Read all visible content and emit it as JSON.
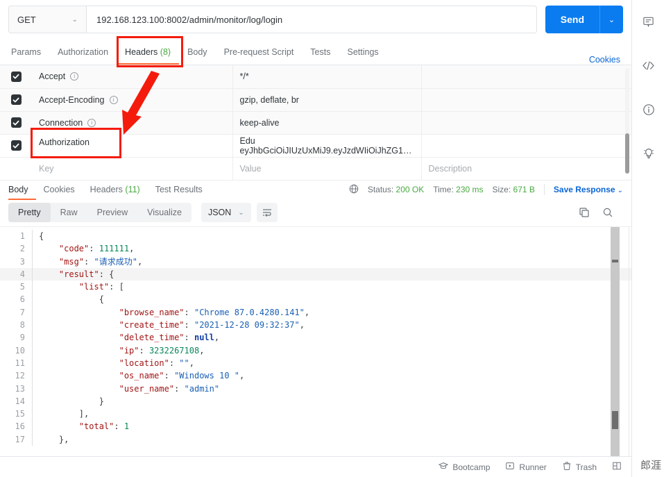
{
  "request": {
    "method": "GET",
    "method_caret": "⌄",
    "url": "192.168.123.100:8002/admin/monitor/log/login",
    "send_label": "Send",
    "send_caret": "⌄",
    "tabs": [
      {
        "label": "Params",
        "active": false
      },
      {
        "label": "Authorization",
        "active": false
      },
      {
        "label": "Headers",
        "count": "(8)",
        "active": true
      },
      {
        "label": "Body",
        "active": false
      },
      {
        "label": "Pre-request Script",
        "active": false
      },
      {
        "label": "Tests",
        "active": false
      },
      {
        "label": "Settings",
        "active": false
      }
    ],
    "cookies_link": "Cookies"
  },
  "headers_table": {
    "columns": [
      "Key",
      "Value",
      "Description"
    ],
    "placeholders": {
      "key": "Key",
      "value": "Value",
      "description": "Description"
    },
    "rows": [
      {
        "checked": true,
        "key": "Accept",
        "has_info": true,
        "value": "*/*",
        "description": ""
      },
      {
        "checked": true,
        "key": "Accept-Encoding",
        "has_info": true,
        "value": "gzip, deflate, br",
        "description": ""
      },
      {
        "checked": true,
        "key": "Connection",
        "has_info": true,
        "value": "keep-alive",
        "description": ""
      },
      {
        "checked": true,
        "key": "Authorization",
        "has_info": false,
        "value": "Edu eyJhbGciOiJIUzUxMiJ9.eyJzdWIiOiJhZG1…",
        "description": ""
      }
    ]
  },
  "response": {
    "tabs": [
      {
        "label": "Body",
        "active": true
      },
      {
        "label": "Cookies",
        "active": false
      },
      {
        "label": "Headers",
        "count": "(11)",
        "active": false
      },
      {
        "label": "Test Results",
        "active": false
      }
    ],
    "status_label": "Status:",
    "status_value": "200 OK",
    "time_label": "Time:",
    "time_value": "230 ms",
    "size_label": "Size:",
    "size_value": "671 B",
    "save_response": "Save Response",
    "save_caret": "⌄",
    "view_modes": [
      {
        "label": "Pretty",
        "active": true
      },
      {
        "label": "Raw",
        "active": false
      },
      {
        "label": "Preview",
        "active": false
      },
      {
        "label": "Visualize",
        "active": false
      }
    ],
    "format": "JSON",
    "format_caret": "⌄"
  },
  "body_json": {
    "lines": [
      {
        "no": "1",
        "indent": 0,
        "tokens": [
          {
            "t": "p",
            "v": "{"
          }
        ]
      },
      {
        "no": "2",
        "indent": 1,
        "tokens": [
          {
            "t": "k",
            "v": "\"code\""
          },
          {
            "t": "p",
            "v": ": "
          },
          {
            "t": "n",
            "v": "111111"
          },
          {
            "t": "p",
            "v": ","
          }
        ]
      },
      {
        "no": "3",
        "indent": 1,
        "tokens": [
          {
            "t": "k",
            "v": "\"msg\""
          },
          {
            "t": "p",
            "v": ": "
          },
          {
            "t": "s",
            "v": "\"请求成功\""
          },
          {
            "t": "p",
            "v": ","
          }
        ]
      },
      {
        "no": "4",
        "indent": 1,
        "highlight": true,
        "tokens": [
          {
            "t": "k",
            "v": "\"result\""
          },
          {
            "t": "p",
            "v": ": "
          },
          {
            "t": "p",
            "v": "{"
          }
        ]
      },
      {
        "no": "5",
        "indent": 2,
        "tokens": [
          {
            "t": "k",
            "v": "\"list\""
          },
          {
            "t": "p",
            "v": ": ["
          }
        ]
      },
      {
        "no": "6",
        "indent": 3,
        "tokens": [
          {
            "t": "p",
            "v": "{"
          }
        ]
      },
      {
        "no": "7",
        "indent": 4,
        "tokens": [
          {
            "t": "k",
            "v": "\"browse_name\""
          },
          {
            "t": "p",
            "v": ": "
          },
          {
            "t": "s",
            "v": "\"Chrome 87.0.4280.141\""
          },
          {
            "t": "p",
            "v": ","
          }
        ]
      },
      {
        "no": "8",
        "indent": 4,
        "tokens": [
          {
            "t": "k",
            "v": "\"create_time\""
          },
          {
            "t": "p",
            "v": ": "
          },
          {
            "t": "s",
            "v": "\"2021-12-28 09:32:37\""
          },
          {
            "t": "p",
            "v": ","
          }
        ]
      },
      {
        "no": "9",
        "indent": 4,
        "tokens": [
          {
            "t": "k",
            "v": "\"delete_time\""
          },
          {
            "t": "p",
            "v": ": "
          },
          {
            "t": "b",
            "v": "null"
          },
          {
            "t": "p",
            "v": ","
          }
        ]
      },
      {
        "no": "10",
        "indent": 4,
        "tokens": [
          {
            "t": "k",
            "v": "\"ip\""
          },
          {
            "t": "p",
            "v": ": "
          },
          {
            "t": "n",
            "v": "3232267108"
          },
          {
            "t": "p",
            "v": ","
          }
        ]
      },
      {
        "no": "11",
        "indent": 4,
        "tokens": [
          {
            "t": "k",
            "v": "\"location\""
          },
          {
            "t": "p",
            "v": ": "
          },
          {
            "t": "s",
            "v": "\"\""
          },
          {
            "t": "p",
            "v": ","
          }
        ]
      },
      {
        "no": "12",
        "indent": 4,
        "tokens": [
          {
            "t": "k",
            "v": "\"os_name\""
          },
          {
            "t": "p",
            "v": ": "
          },
          {
            "t": "s",
            "v": "\"Windows 10 \""
          },
          {
            "t": "p",
            "v": ","
          }
        ]
      },
      {
        "no": "13",
        "indent": 4,
        "tokens": [
          {
            "t": "k",
            "v": "\"user_name\""
          },
          {
            "t": "p",
            "v": ": "
          },
          {
            "t": "s",
            "v": "\"admin\""
          }
        ]
      },
      {
        "no": "14",
        "indent": 3,
        "tokens": [
          {
            "t": "p",
            "v": "}"
          }
        ]
      },
      {
        "no": "15",
        "indent": 2,
        "tokens": [
          {
            "t": "p",
            "v": "],"
          }
        ]
      },
      {
        "no": "16",
        "indent": 2,
        "tokens": [
          {
            "t": "k",
            "v": "\"total\""
          },
          {
            "t": "p",
            "v": ": "
          },
          {
            "t": "n",
            "v": "1"
          }
        ]
      },
      {
        "no": "17",
        "indent": 1,
        "tokens": [
          {
            "t": "p",
            "v": "},"
          }
        ]
      }
    ]
  },
  "footer": {
    "items": [
      {
        "icon": "bootcamp-icon",
        "label": "Bootcamp"
      },
      {
        "icon": "runner-icon",
        "label": "Runner"
      },
      {
        "icon": "trash-icon",
        "label": "Trash"
      }
    ],
    "watermark": "郎涯"
  },
  "rail": {
    "icons": [
      "comment-icon",
      "code-icon",
      "info-icon",
      "lightbulb-icon"
    ]
  },
  "annotations": {
    "highlight_color": "#f41b0c",
    "boxes": [
      "headers-tab-highlight",
      "authorization-key-highlight"
    ],
    "arrow": "arrow-pointing-to-authorization",
    "auth_label": "Authorization"
  }
}
